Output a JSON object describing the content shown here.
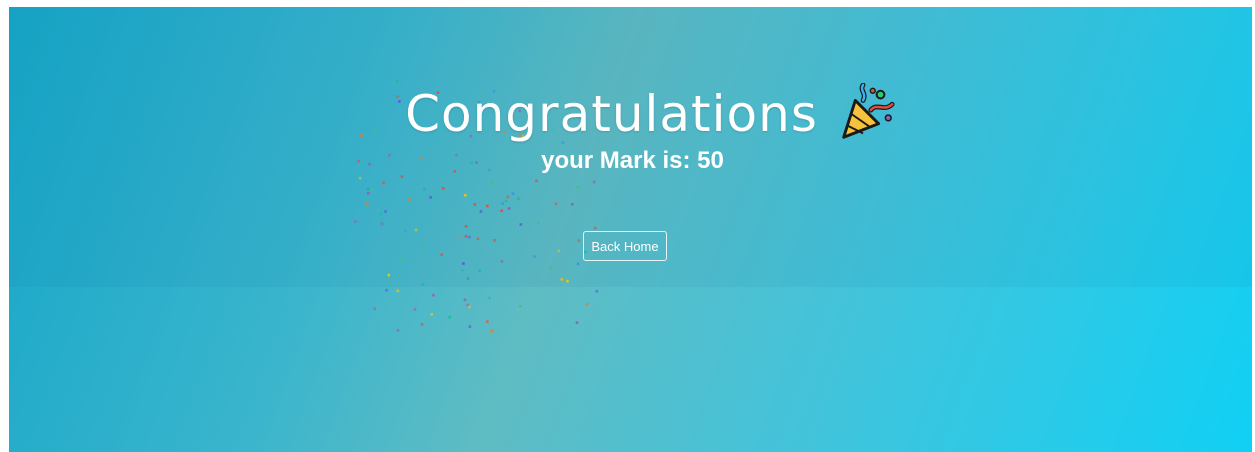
{
  "result": {
    "title": "Congratulations",
    "mark_label": "your Mark is:",
    "mark_value": "50",
    "back_button_label": "Back Home"
  },
  "icons": {
    "celebration": "party-popper-icon"
  },
  "colors": {
    "gradient_start": "#17a7c8",
    "gradient_mid": "#5fbcc3",
    "gradient_end": "#10d0f4",
    "text": "#ffffff"
  }
}
